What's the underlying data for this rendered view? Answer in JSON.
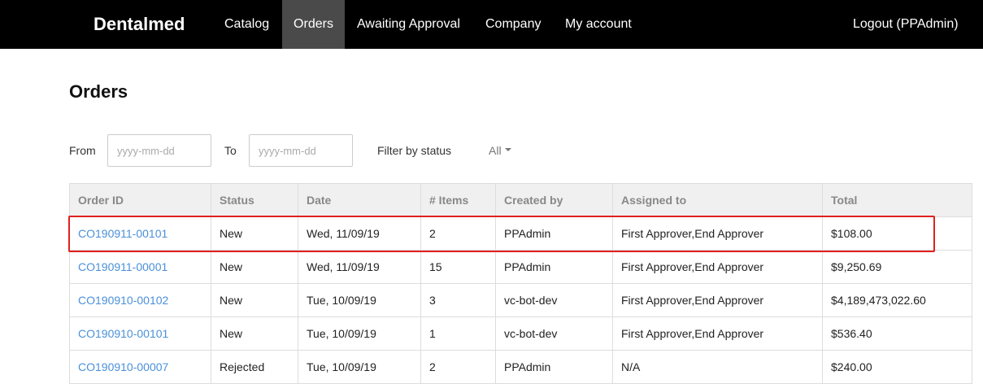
{
  "header": {
    "brand": "Dentalmed",
    "nav": [
      {
        "label": "Catalog",
        "active": false
      },
      {
        "label": "Orders",
        "active": true
      },
      {
        "label": "Awaiting Approval",
        "active": false
      },
      {
        "label": "Company",
        "active": false
      },
      {
        "label": "My account",
        "active": false
      }
    ],
    "logout_label": "Logout (PPAdmin)"
  },
  "page": {
    "title": "Orders"
  },
  "filters": {
    "from_label": "From",
    "from_placeholder": "yyyy-mm-dd",
    "to_label": "To",
    "to_placeholder": "yyyy-mm-dd",
    "status_label": "Filter by status",
    "status_value": "All"
  },
  "table": {
    "columns": [
      "Order ID",
      "Status",
      "Date",
      "# Items",
      "Created by",
      "Assigned to",
      "Total"
    ],
    "rows": [
      [
        "CO190911-00101",
        "New",
        "Wed, 11/09/19",
        "2",
        "PPAdmin",
        "First Approver,End Approver",
        "$108.00"
      ],
      [
        "CO190911-00001",
        "New",
        "Wed, 11/09/19",
        "15",
        "PPAdmin",
        "First Approver,End Approver",
        "$9,250.69"
      ],
      [
        "CO190910-00102",
        "New",
        "Tue, 10/09/19",
        "3",
        "vc-bot-dev",
        "First Approver,End Approver",
        "$4,189,473,022.60"
      ],
      [
        "CO190910-00101",
        "New",
        "Tue, 10/09/19",
        "1",
        "vc-bot-dev",
        "First Approver,End Approver",
        "$536.40"
      ],
      [
        "CO190910-00007",
        "Rejected",
        "Tue, 10/09/19",
        "2",
        "PPAdmin",
        "N/A",
        "$240.00"
      ]
    ],
    "highlighted_row": 0
  },
  "colors": {
    "topbar": "#000000",
    "nav_active": "#4a4a4a",
    "link": "#4a90d9",
    "highlight": "#e02020"
  }
}
